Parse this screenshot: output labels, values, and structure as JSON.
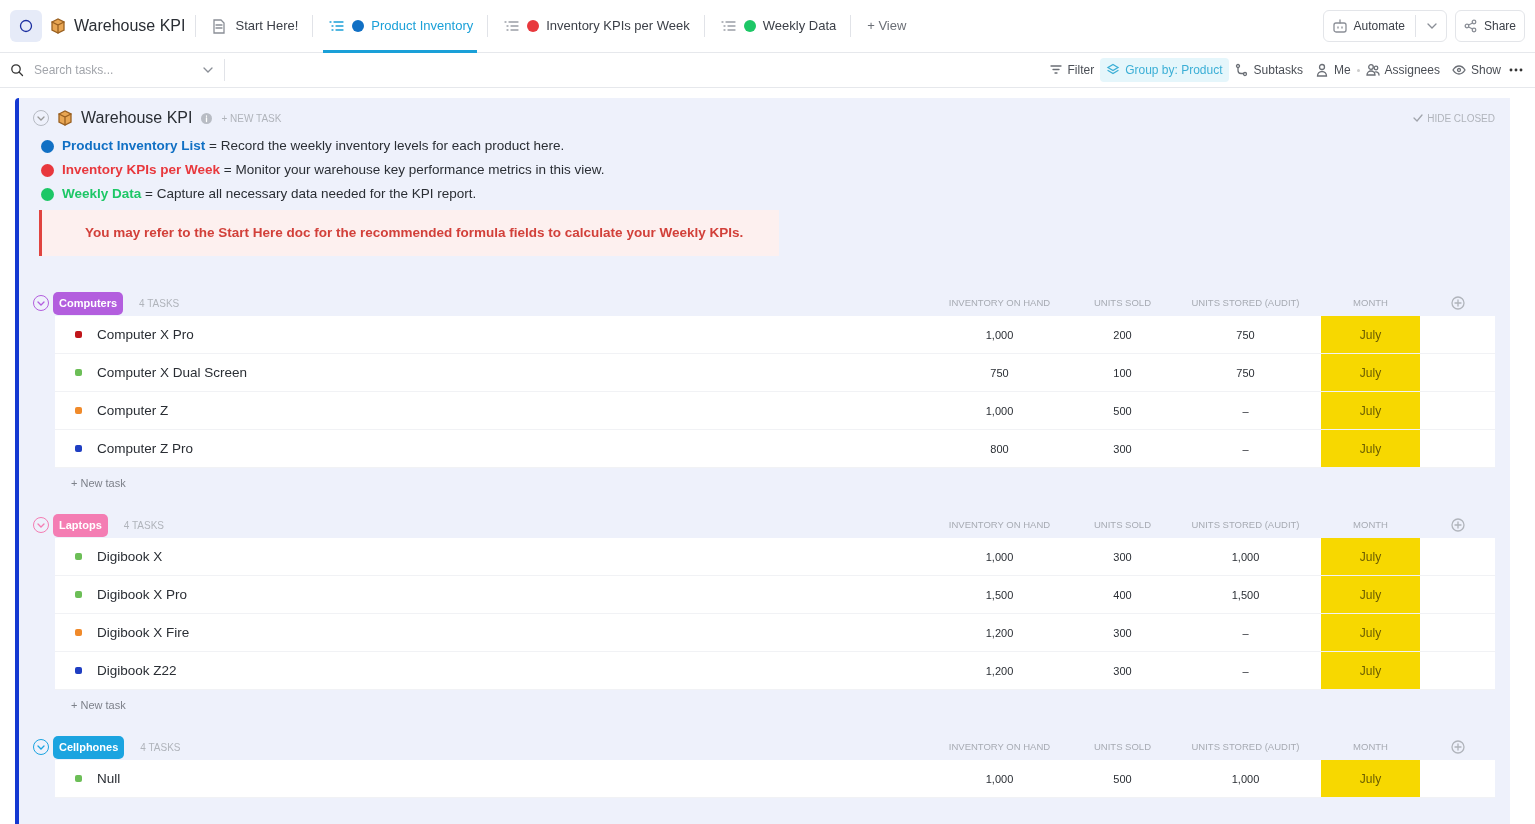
{
  "header": {
    "title": "Warehouse KPI",
    "tabs": [
      {
        "label": "Start Here!",
        "kind": "doc",
        "selected": false
      },
      {
        "label": "Product Inventory",
        "kind": "list",
        "color": "#1170c4",
        "selected": true
      },
      {
        "label": "Inventory KPIs per Week",
        "kind": "list",
        "color": "#e8383d",
        "selected": false
      },
      {
        "label": "Weekly Data",
        "kind": "list",
        "color": "#1dc766",
        "selected": false
      }
    ],
    "add_view": "+ View",
    "automate": "Automate",
    "share": "Share"
  },
  "toolbar": {
    "search_placeholder": "Search tasks...",
    "items": [
      {
        "label": "Filter",
        "kind": "filter",
        "selected": false
      },
      {
        "label": "Group by: Product",
        "kind": "group",
        "selected": true
      },
      {
        "label": "Subtasks",
        "kind": "subtasks",
        "selected": false
      },
      {
        "label": "Me",
        "kind": "me",
        "selected": false
      },
      {
        "label": "Assignees",
        "kind": "assignees",
        "selected": false
      },
      {
        "label": "Show",
        "kind": "show",
        "selected": false
      }
    ]
  },
  "list": {
    "title": "Warehouse KPI",
    "new_task": "+ NEW TASK",
    "hide_closed": "HIDE CLOSED",
    "legend": [
      {
        "name": "Product Inventory List",
        "color": "#1170c4",
        "text": "= Record the weekly inventory levels for each product here."
      },
      {
        "name": "Inventory KPIs per Week",
        "color": "#e8383d",
        "text": "= Monitor your warehouse key performance metrics in this view."
      },
      {
        "name": "Weekly Data",
        "color": "#1dc766",
        "text": "= Capture all necessary data needed for the KPI report."
      }
    ],
    "note": "You may refer to the Start Here doc for the recommended formula fields to calculate your Weekly KPIs.",
    "groups": [
      {
        "name": "Computers",
        "color": "#b35ede",
        "count": "4 TASKS",
        "columns": [
          "INVENTORY ON HAND",
          "UNITS SOLD",
          "UNITS STORED (AUDIT)",
          "MONTH"
        ],
        "new_task": "+ New task",
        "rows": [
          {
            "name": "Computer X Pro",
            "color": "#c0161a",
            "cells": [
              "1,000",
              "200",
              "750",
              "July"
            ]
          },
          {
            "name": "Computer X Dual Screen",
            "color": "#6cbe57",
            "cells": [
              "750",
              "100",
              "750",
              "July"
            ]
          },
          {
            "name": "Computer Z",
            "color": "#f08a2a",
            "cells": [
              "1,000",
              "500",
              "–",
              "July"
            ]
          },
          {
            "name": "Computer Z Pro",
            "color": "#1f3ec2",
            "cells": [
              "800",
              "300",
              "–",
              "July"
            ]
          }
        ]
      },
      {
        "name": "Laptops",
        "color": "#f47db3",
        "count": "4 TASKS",
        "columns": [
          "INVENTORY ON HAND",
          "UNITS SOLD",
          "UNITS STORED (AUDIT)",
          "MONTH"
        ],
        "new_task": "+ New task",
        "rows": [
          {
            "name": "Digibook X",
            "color": "#6cbe57",
            "cells": [
              "1,000",
              "300",
              "1,000",
              "July"
            ]
          },
          {
            "name": "Digibook X Pro",
            "color": "#6cbe57",
            "cells": [
              "1,500",
              "400",
              "1,500",
              "July"
            ]
          },
          {
            "name": "Digibook X Fire",
            "color": "#f08a2a",
            "cells": [
              "1,200",
              "300",
              "–",
              "July"
            ]
          },
          {
            "name": "Digibook Z22",
            "color": "#1f3ec2",
            "cells": [
              "1,200",
              "300",
              "–",
              "July"
            ]
          }
        ]
      },
      {
        "name": "Cellphones",
        "color": "#1ba4e0",
        "count": "4 TASKS",
        "columns": [
          "INVENTORY ON HAND",
          "UNITS SOLD",
          "UNITS STORED (AUDIT)",
          "MONTH"
        ],
        "rows": [
          {
            "name": "Null",
            "color": "#6cbe57",
            "cells": [
              "1,000",
              "500",
              "1,000",
              "July"
            ]
          }
        ]
      }
    ]
  }
}
